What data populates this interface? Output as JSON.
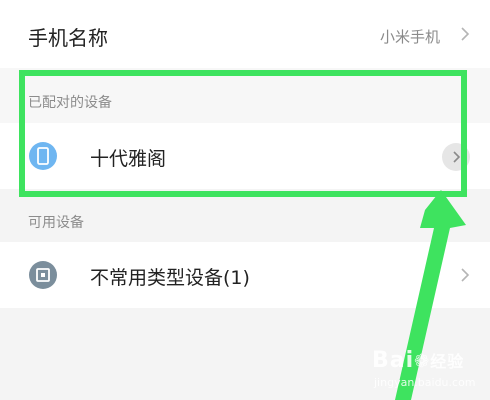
{
  "phone_name": {
    "label": "手机名称",
    "value": "小米手机"
  },
  "paired": {
    "header": "已配对的设备",
    "devices": [
      {
        "label": "十代雅阁",
        "icon": "phone-icon"
      }
    ]
  },
  "available": {
    "header": "可用设备",
    "devices": [
      {
        "label": "不常用类型设备(1)",
        "icon": "unknown-device-icon"
      }
    ]
  },
  "annotation": {
    "highlight_color": "#3ee35f"
  },
  "watermark": {
    "brand": "Bai",
    "brand_suffix": "经验",
    "url": "jingyan.baidu.com"
  },
  "colors": {
    "paired_icon": "#6fb6f1",
    "other_icon": "#7b8e9c"
  }
}
